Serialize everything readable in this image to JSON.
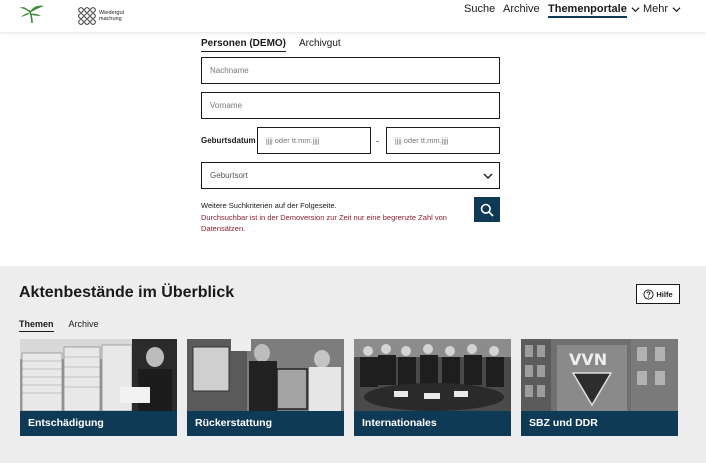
{
  "header": {
    "logo_text": "Wiedergut machung",
    "nav": [
      {
        "label": "Suche"
      },
      {
        "label": "Archive"
      },
      {
        "label": "Themenportale"
      },
      {
        "label": "Mehr"
      }
    ]
  },
  "search": {
    "tabs": [
      "Personen (DEMO)",
      "Archivgut"
    ],
    "lastname_placeholder": "Nachname",
    "firstname_placeholder": "Vorname",
    "birthdate_label": "Geburtsdatum",
    "date_from_placeholder": "jjjj oder tt.mm.jjjj",
    "date_separator": "-",
    "date_to_placeholder": "jjjj oder tt.mm.jjjj",
    "birthplace_placeholder": "Geburtsort",
    "hint": "Weitere Suchkriterien auf der Folgeseite.",
    "notice": "Durchsuchbar ist in der Demoversion zur Zeit nur eine begrenzte Zahl von Datensätzen."
  },
  "overview": {
    "title": "Aktenbestände im Überblick",
    "help_label": "Hilfe",
    "tabs": [
      "Themen",
      "Archive"
    ],
    "cards": [
      {
        "label": "Entschädigung"
      },
      {
        "label": "Rückerstattung"
      },
      {
        "label": "Internationales"
      },
      {
        "label": "SBZ und DDR"
      }
    ]
  },
  "colors": {
    "primary": "#0f3a56",
    "notice": "#8b1d2c",
    "section_bg": "#ededed",
    "logo_green": "#3f8a3c"
  }
}
